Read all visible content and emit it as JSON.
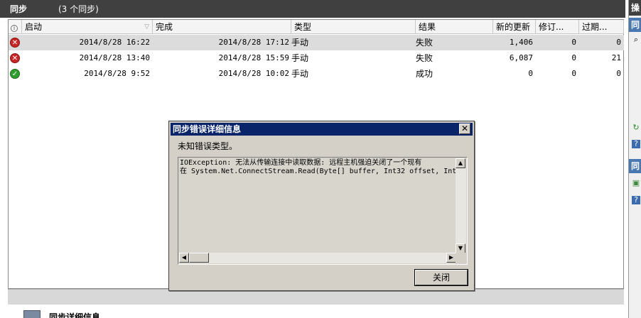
{
  "sync_panel": {
    "title": "同步",
    "count": "(3 个同步)",
    "columns": {
      "info": "i",
      "start": "启动",
      "finish": "完成",
      "type": "类型",
      "result": "结果",
      "new_updates": "新的更新",
      "revisions": "修订...",
      "expired": "过期..."
    },
    "rows": [
      {
        "status_icon": "error-icon",
        "start": "2014/8/28 16:22",
        "finish": "2014/8/28 17:12",
        "type": "手动",
        "result": "失败",
        "new_updates": "1,406",
        "revisions": "0",
        "expired": "0"
      },
      {
        "status_icon": "error-icon",
        "start": "2014/8/28 13:40",
        "finish": "2014/8/28 15:59",
        "type": "手动",
        "result": "失败",
        "new_updates": "6,087",
        "revisions": "0",
        "expired": "21"
      },
      {
        "status_icon": "success-icon",
        "start": "2014/8/28 9:52",
        "finish": "2014/8/28 10:02",
        "type": "手动",
        "result": "成功",
        "new_updates": "0",
        "revisions": "0",
        "expired": "0"
      }
    ]
  },
  "details": {
    "title": "同步详细信息"
  },
  "action_pane": {
    "header": "操",
    "section1": "同",
    "section2": "同"
  },
  "dialog": {
    "title": "同步错误详细信息",
    "close_glyph": "✕",
    "message": "未知错误类型。",
    "detail_line1": "IOException: 无法从传输连接中读取数据: 远程主机强迫关闭了一个现有",
    "detail_line2": "在 System.Net.ConnectStream.Read(Byte[] buffer, Int32 offset, Int",
    "close_button": "关闭"
  },
  "colors": {
    "header_bg": "#404040",
    "dialog_title_bg": "#0a246a",
    "error": "#c62828",
    "success": "#2e9e2e"
  }
}
